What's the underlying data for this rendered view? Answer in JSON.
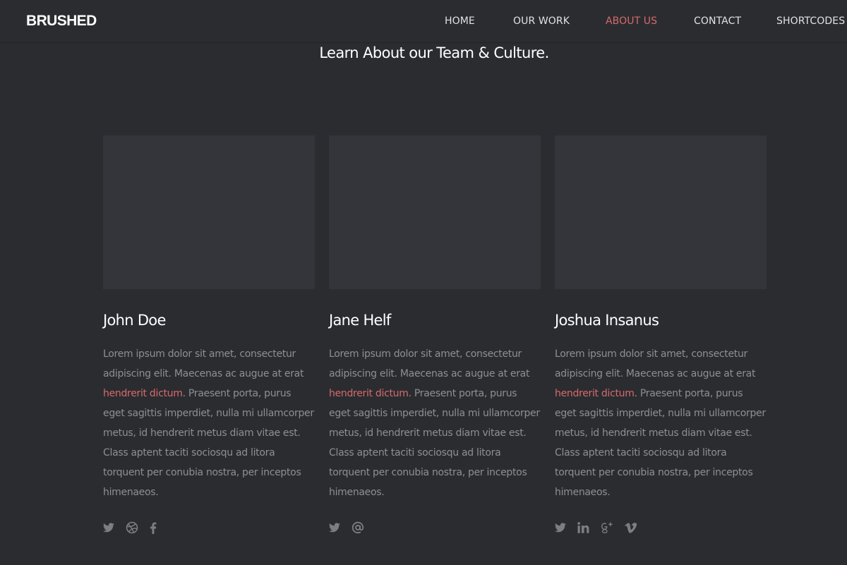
{
  "nav": {
    "brand": "BRUSHED",
    "items": [
      {
        "label": "HOME"
      },
      {
        "label": "OUR WORK"
      },
      {
        "label": "ABOUT US"
      },
      {
        "label": "CONTACT"
      },
      {
        "label": "SHORTCODES"
      }
    ],
    "active_color": "#d56a6d"
  },
  "section": {
    "title": "Learn About our Team & Culture."
  },
  "team": [
    {
      "name": "John Doe",
      "bio_before": "Lorem ipsum dolor sit amet, consectetur adipiscing elit. Maecenas ac augue at erat ",
      "bio_link": "hendrerit dictum",
      "bio_after": ". Praesent porta, purus eget sagittis imperdiet, nulla mi ullamcorper metus, id hendrerit metus diam vitae est. Class aptent taciti sociosqu ad litora torquent per conubia nostra, per inceptos himenaeos.",
      "social": [
        "twitter-icon",
        "dribbble-icon",
        "facebook-icon"
      ]
    },
    {
      "name": "Jane Helf",
      "bio_before": "Lorem ipsum dolor sit amet, consectetur adipiscing elit. Maecenas ac augue at erat ",
      "bio_link": "hendrerit dictum",
      "bio_after": ". Praesent porta, purus eget sagittis imperdiet, nulla mi ullamcorper metus, id hendrerit metus diam vitae est. Class aptent taciti sociosqu ad litora torquent per conubia nostra, per inceptos himenaeos.",
      "social": [
        "twitter-icon",
        "email-icon"
      ]
    },
    {
      "name": "Joshua Insanus",
      "bio_before": "Lorem ipsum dolor sit amet, consectetur adipiscing elit. Maecenas ac augue at erat ",
      "bio_link": "hendrerit dictum",
      "bio_after": ". Praesent porta, purus eget sagittis imperdiet, nulla mi ullamcorper metus, id hendrerit metus diam vitae est. Class aptent taciti sociosqu ad litora torquent per conubia nostra, per inceptos himenaeos.",
      "social": [
        "twitter-icon",
        "linkedin-icon",
        "google-plus-icon",
        "vimeo-icon"
      ]
    }
  ],
  "colors": {
    "background": "#2b2c30",
    "photo_placeholder": "#34353a",
    "accent": "#d56a6d",
    "body_text": "#8f8f93"
  }
}
